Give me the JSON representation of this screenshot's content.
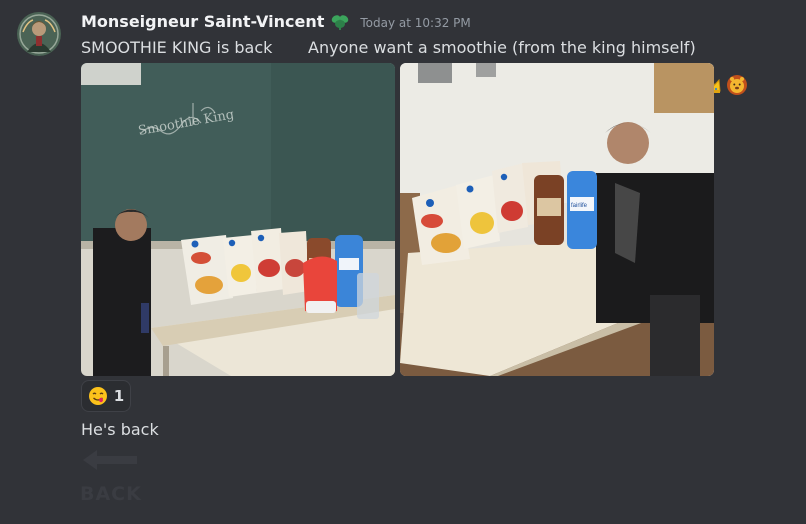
{
  "message": {
    "author": "Monseigneur Saint-Vincent",
    "timestamp": "Today at 10:32 PM",
    "content": "SMOOTHIE KING is back       Anyone want a smoothie (from the king himself)",
    "content_emojis": [
      "crown-emoji",
      "lion-face-emoji"
    ],
    "role_icon": "green-leaf-role-icon",
    "attachments": [
      {
        "name": "classroom-chalkboard-photo",
        "chalk_text": "Smoothie King"
      },
      {
        "name": "classroom-table-photo",
        "bottle_label": "fairlife"
      }
    ]
  },
  "reaction": {
    "emoji": "face-savoring-food-emoji",
    "count": "1"
  },
  "followup_message": {
    "content": "He's back"
  },
  "faded_element": {
    "text": "BACK"
  },
  "colors": {
    "background": "#313338",
    "username": "#f2f3f5",
    "text": "#dbdee1",
    "timestamp": "#949ba4",
    "reaction_bg": "#2b2d31"
  }
}
